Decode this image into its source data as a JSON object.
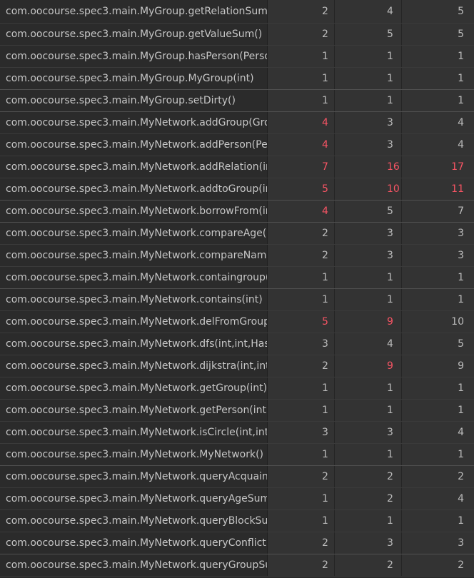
{
  "metrics_table": {
    "warn_color": "#f75464",
    "rows": [
      {
        "method": "com.oocourse.spec3.main.MyGroup.getRelationSum()",
        "v1": "2",
        "v2": "4",
        "v3": "5",
        "w1": false,
        "w2": false,
        "w3": false
      },
      {
        "method": "com.oocourse.spec3.main.MyGroup.getValueSum()",
        "v1": "2",
        "v2": "5",
        "v3": "5",
        "w1": false,
        "w2": false,
        "w3": false
      },
      {
        "method": "com.oocourse.spec3.main.MyGroup.hasPerson(Person)",
        "v1": "1",
        "v2": "1",
        "v3": "1",
        "w1": false,
        "w2": false,
        "w3": false
      },
      {
        "method": "com.oocourse.spec3.main.MyGroup.MyGroup(int)",
        "v1": "1",
        "v2": "1",
        "v3": "1",
        "w1": false,
        "w2": false,
        "w3": false
      },
      {
        "method": "com.oocourse.spec3.main.MyGroup.setDirty()",
        "v1": "1",
        "v2": "1",
        "v3": "1",
        "w1": false,
        "w2": false,
        "w3": false
      },
      {
        "method": "com.oocourse.spec3.main.MyNetwork.addGroup(Group)",
        "v1": "4",
        "v2": "3",
        "v3": "4",
        "w1": true,
        "w2": false,
        "w3": false
      },
      {
        "method": "com.oocourse.spec3.main.MyNetwork.addPerson(Person)",
        "v1": "4",
        "v2": "3",
        "v3": "4",
        "w1": true,
        "w2": false,
        "w3": false
      },
      {
        "method": "com.oocourse.spec3.main.MyNetwork.addRelation(int,int,int)",
        "v1": "7",
        "v2": "16",
        "v3": "17",
        "w1": true,
        "w2": true,
        "w3": true
      },
      {
        "method": "com.oocourse.spec3.main.MyNetwork.addtoGroup(int,int)",
        "v1": "5",
        "v2": "10",
        "v3": "11",
        "w1": true,
        "w2": true,
        "w3": true
      },
      {
        "method": "com.oocourse.spec3.main.MyNetwork.borrowFrom(int,int,int)",
        "v1": "4",
        "v2": "5",
        "v3": "7",
        "w1": true,
        "w2": false,
        "w3": false
      },
      {
        "method": "com.oocourse.spec3.main.MyNetwork.compareAge(int,int)",
        "v1": "2",
        "v2": "3",
        "v3": "3",
        "w1": false,
        "w2": false,
        "w3": false
      },
      {
        "method": "com.oocourse.spec3.main.MyNetwork.compareName(int,int)",
        "v1": "2",
        "v2": "3",
        "v3": "3",
        "w1": false,
        "w2": false,
        "w3": false
      },
      {
        "method": "com.oocourse.spec3.main.MyNetwork.containgroup(int)",
        "v1": "1",
        "v2": "1",
        "v3": "1",
        "w1": false,
        "w2": false,
        "w3": false
      },
      {
        "method": "com.oocourse.spec3.main.MyNetwork.contains(int)",
        "v1": "1",
        "v2": "1",
        "v3": "1",
        "w1": false,
        "w2": false,
        "w3": false
      },
      {
        "method": "com.oocourse.spec3.main.MyNetwork.delFromGroup(int,int)",
        "v1": "5",
        "v2": "9",
        "v3": "10",
        "w1": true,
        "w2": true,
        "w3": false
      },
      {
        "method": "com.oocourse.spec3.main.MyNetwork.dfs(int,int,HashSet)",
        "v1": "3",
        "v2": "4",
        "v3": "5",
        "w1": false,
        "w2": false,
        "w3": false
      },
      {
        "method": "com.oocourse.spec3.main.MyNetwork.dijkstra(int,int)",
        "v1": "2",
        "v2": "9",
        "v3": "9",
        "w1": false,
        "w2": true,
        "w3": false
      },
      {
        "method": "com.oocourse.spec3.main.MyNetwork.getGroup(int)",
        "v1": "1",
        "v2": "1",
        "v3": "1",
        "w1": false,
        "w2": false,
        "w3": false
      },
      {
        "method": "com.oocourse.spec3.main.MyNetwork.getPerson(int)",
        "v1": "1",
        "v2": "1",
        "v3": "1",
        "w1": false,
        "w2": false,
        "w3": false
      },
      {
        "method": "com.oocourse.spec3.main.MyNetwork.isCircle(int,int)",
        "v1": "3",
        "v2": "3",
        "v3": "4",
        "w1": false,
        "w2": false,
        "w3": false
      },
      {
        "method": "com.oocourse.spec3.main.MyNetwork.MyNetwork()",
        "v1": "1",
        "v2": "1",
        "v3": "1",
        "w1": false,
        "w2": false,
        "w3": false
      },
      {
        "method": "com.oocourse.spec3.main.MyNetwork.queryAcquaintanceSum()",
        "v1": "2",
        "v2": "2",
        "v3": "2",
        "w1": false,
        "w2": false,
        "w3": false
      },
      {
        "method": "com.oocourse.spec3.main.MyNetwork.queryAgeSum(int,int)",
        "v1": "1",
        "v2": "2",
        "v3": "4",
        "w1": false,
        "w2": false,
        "w3": false
      },
      {
        "method": "com.oocourse.spec3.main.MyNetwork.queryBlockSum()",
        "v1": "1",
        "v2": "1",
        "v3": "1",
        "w1": false,
        "w2": false,
        "w3": false
      },
      {
        "method": "com.oocourse.spec3.main.MyNetwork.queryConflict(int)",
        "v1": "2",
        "v2": "3",
        "v3": "3",
        "w1": false,
        "w2": false,
        "w3": false
      },
      {
        "method": "com.oocourse.spec3.main.MyNetwork.queryGroupSum()",
        "v1": "2",
        "v2": "2",
        "v3": "2",
        "w1": false,
        "w2": false,
        "w3": false
      }
    ]
  }
}
